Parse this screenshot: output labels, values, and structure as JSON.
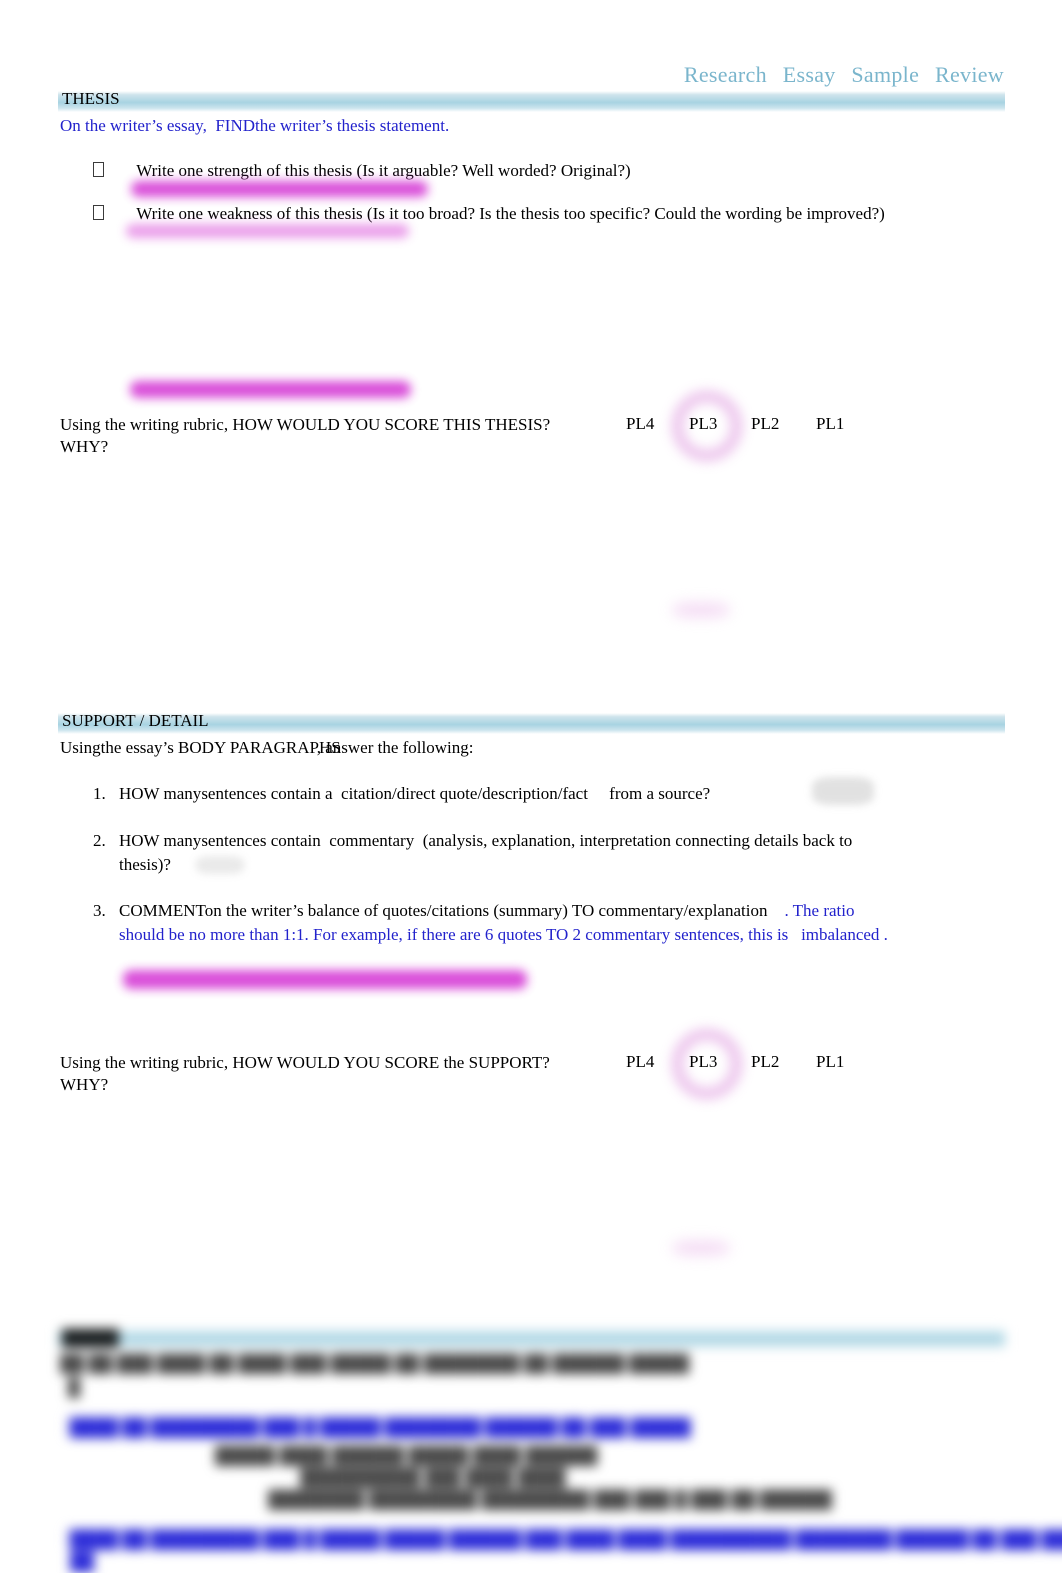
{
  "document": {
    "title_words": [
      "Research",
      "Essay",
      "Sample",
      "Review"
    ],
    "title_color": "#7ab5cc"
  },
  "sections": [
    {
      "id": "thesis",
      "band_label": "THESIS",
      "intro_black": "On the writer’s essay,",
      "intro_blue_lead": "FIND",
      "intro_blue_rest": "the writer’s thesis statement.",
      "intro_full": "On the writer’s essay, FIND the writer’s thesis statement.",
      "bullets": [
        "Write one strength of this thesis (Is it arguable? Well worded? Original?)",
        "Write one weakness of this thesis (Is it too broad? Is the thesis too specific? Could the wording be improved?)"
      ],
      "score_prompt_line1": "Using the writing rubric, HOW WOULD YOU SCORE THIS THESIS?",
      "score_prompt_line2": "WHY?",
      "score_options": [
        "PL4",
        "PL3",
        "PL2",
        "PL1"
      ],
      "score_circled": "PL3"
    },
    {
      "id": "support",
      "band_label": "SUPPORT / DETAIL",
      "intro_a": "Using",
      "intro_b": "the essay’s BODY PARAGRAPHS",
      "intro_c": ", answer the following:",
      "intro_full": "Using the essay’s BODY PARAGRAPHS, answer the following:",
      "items": [
        {
          "number": "1.",
          "parts": [
            {
              "text": "HOW many",
              "color": "black"
            },
            {
              "text": "sentences contain a",
              "color": "black"
            },
            {
              "text": "citation/direct quote/description/fact",
              "color": "black"
            },
            {
              "text": "from a source?",
              "color": "black"
            }
          ],
          "plain": "HOW many sentences contain a citation/direct quote/description/fact from a source?"
        },
        {
          "number": "2.",
          "parts": [
            {
              "text": "HOW many",
              "color": "black"
            },
            {
              "text": "sentences contain",
              "color": "black"
            },
            {
              "text": "commentary",
              "color": "black"
            },
            {
              "text": "(analysis, explanation, interpretation connecting details back to",
              "color": "black"
            }
          ],
          "plain": "HOW many sentences contain commentary (analysis, explanation, interpretation connecting details back to thesis)?",
          "second_line": "thesis)?"
        },
        {
          "number": "3.",
          "parts": [
            {
              "text": "COMMENT",
              "color": "black"
            },
            {
              "text": "on the",
              "color": "black"
            },
            {
              "text": "writer’s balance of quotes/citations (summary) TO commentary/explanation",
              "color": "black"
            },
            {
              "text": ". The ratio",
              "color": "blue"
            }
          ],
          "plain": "COMMENT on the writer’s balance of quotes/citations (summary) TO commentary/explanation. The ratio should be no more than 1:1. For example, if there are 6 quotes TO 2 commentary sentences, this is imbalanced.",
          "second_line_blue_a": "should be no more than 1:1. For example, if there are 6 quotes TO 2 commentary sentences, this is",
          "second_line_blue_b": "imbalanced",
          "second_line_blue_c": "."
        }
      ],
      "score_prompt_line1": "Using the writing rubric, HOW WOULD YOU SCORE the SUPPORT?",
      "score_prompt_line2": "WHY?",
      "score_options": [
        "PL4",
        "PL3",
        "PL2",
        "PL1"
      ],
      "score_circled": "PL3"
    }
  ],
  "bottom_section": {
    "note": "heavily blurred / illegible region",
    "band_label_blurred": "█████",
    "line1_blurred": "██ ██ ███ ████ ██ ████ ███ █████ ██ ████████ ██ ██████ █████",
    "line2_blurred": "█",
    "line3_blurred": "████ ██ █████████ ███ █ █████ ████████ ██████ ██ ███ █████",
    "line4_blurred": "█████     ████ ██████     █████        ████        ██████",
    "line5_blurred": "██████████      ███ ████      ████",
    "line6_blurred": "████████     █████████ █████████ ███ ███ █ ███ ██ ██████",
    "line7_blurred": "████ ██ █████████ ███ █ █████ █████ ██████ ███ ████ ████ ██████████ ████████ ██████ ██ ███ █████████",
    "line8_blurred": "██"
  },
  "annotations": {
    "redaction_color": "#d63fd6",
    "circle_color": "#e3a8e3",
    "description": "magenta highlighter redaction bars, pink circle around PL3, faint handwritten smudges"
  }
}
